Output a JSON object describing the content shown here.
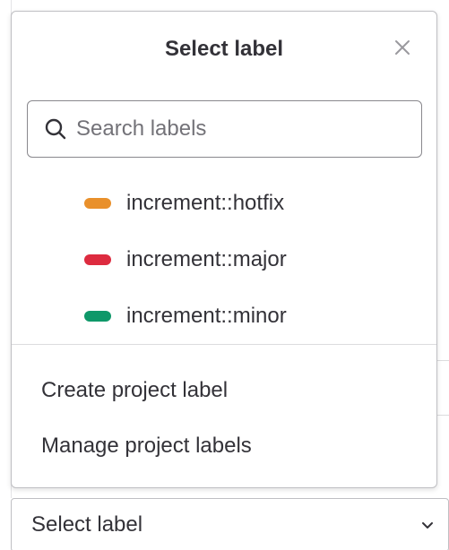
{
  "dropdown": {
    "title": "Select label",
    "close_icon": "close-icon",
    "search": {
      "placeholder": "Search labels",
      "value": "",
      "icon": "search-icon"
    },
    "labels": [
      {
        "name": "increment::hotfix",
        "color": "#e9902b"
      },
      {
        "name": "increment::major",
        "color": "#dd2b3f"
      },
      {
        "name": "increment::minor",
        "color": "#0f9869"
      }
    ],
    "footer": {
      "create_label": "Create project label",
      "manage_label": "Manage project labels"
    }
  },
  "select_toggle": {
    "label": "Select label",
    "icon": "chevron-down-icon"
  }
}
